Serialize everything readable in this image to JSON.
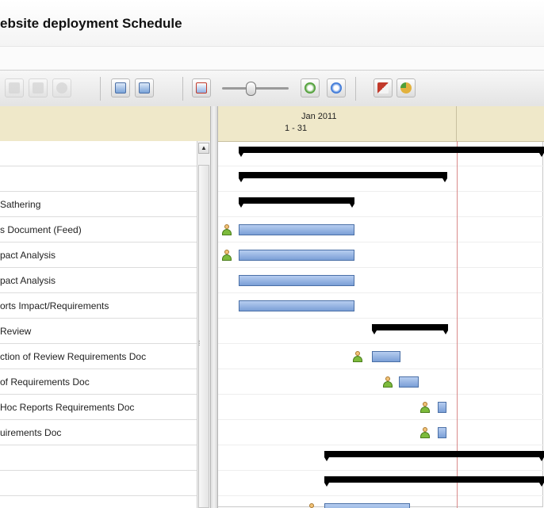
{
  "window": {
    "title": "ebsite deployment Schedule"
  },
  "toolbar": {
    "buttons": [
      {
        "name": "toolbar-button-1",
        "icon": "arrow-icon",
        "disabled": true
      },
      {
        "name": "toolbar-button-2",
        "icon": "grid-icon",
        "disabled": true
      },
      {
        "name": "toolbar-button-3",
        "icon": "circle-icon",
        "disabled": true
      },
      {
        "name": "toolbar-button-4",
        "icon": "copy-icon",
        "disabled": false
      },
      {
        "name": "toolbar-button-5",
        "icon": "paste-icon",
        "disabled": false
      },
      {
        "name": "toolbar-button-6",
        "icon": "zoom-out-icon",
        "disabled": false
      },
      {
        "name": "toolbar-button-7",
        "icon": "zoom-in-icon",
        "disabled": false
      },
      {
        "name": "toolbar-button-8",
        "icon": "zoom-fit-icon",
        "disabled": false
      },
      {
        "name": "toolbar-button-9",
        "icon": "indent-icon",
        "disabled": false
      },
      {
        "name": "toolbar-button-10",
        "icon": "pie-icon",
        "disabled": false
      }
    ],
    "colors": {
      "accent_red": "#c23a2b",
      "accent_green": "#4f9f37",
      "accent_blue": "#3c78d8",
      "accent_yellow": "#e2b13c"
    }
  },
  "timeline": {
    "month": "Jan 2011",
    "days": "1  -  31"
  },
  "tasks": [
    {
      "label": ""
    },
    {
      "label": ""
    },
    {
      "label": "Sathering"
    },
    {
      "label": "s Document (Feed)"
    },
    {
      "label": "pact Analysis"
    },
    {
      "label": "pact Analysis"
    },
    {
      "label": "orts Impact/Requirements"
    },
    {
      "label": "Review"
    },
    {
      "label": "ction of Review Requirements Doc"
    },
    {
      "label": " of Requirements Doc"
    },
    {
      "label": "Hoc Reports Requirements Doc"
    },
    {
      "label": "uirements Doc"
    },
    {
      "label": ""
    },
    {
      "label": ""
    },
    {
      "label": ""
    }
  ],
  "gantt": {
    "colors": {
      "summary": "#000000",
      "task": "#8fb0e3",
      "task_border": "#4a6fa6",
      "today": "#d98a8a"
    }
  },
  "icons": {
    "resource": "person-icon",
    "scroll_up": "arrow-up-icon"
  }
}
